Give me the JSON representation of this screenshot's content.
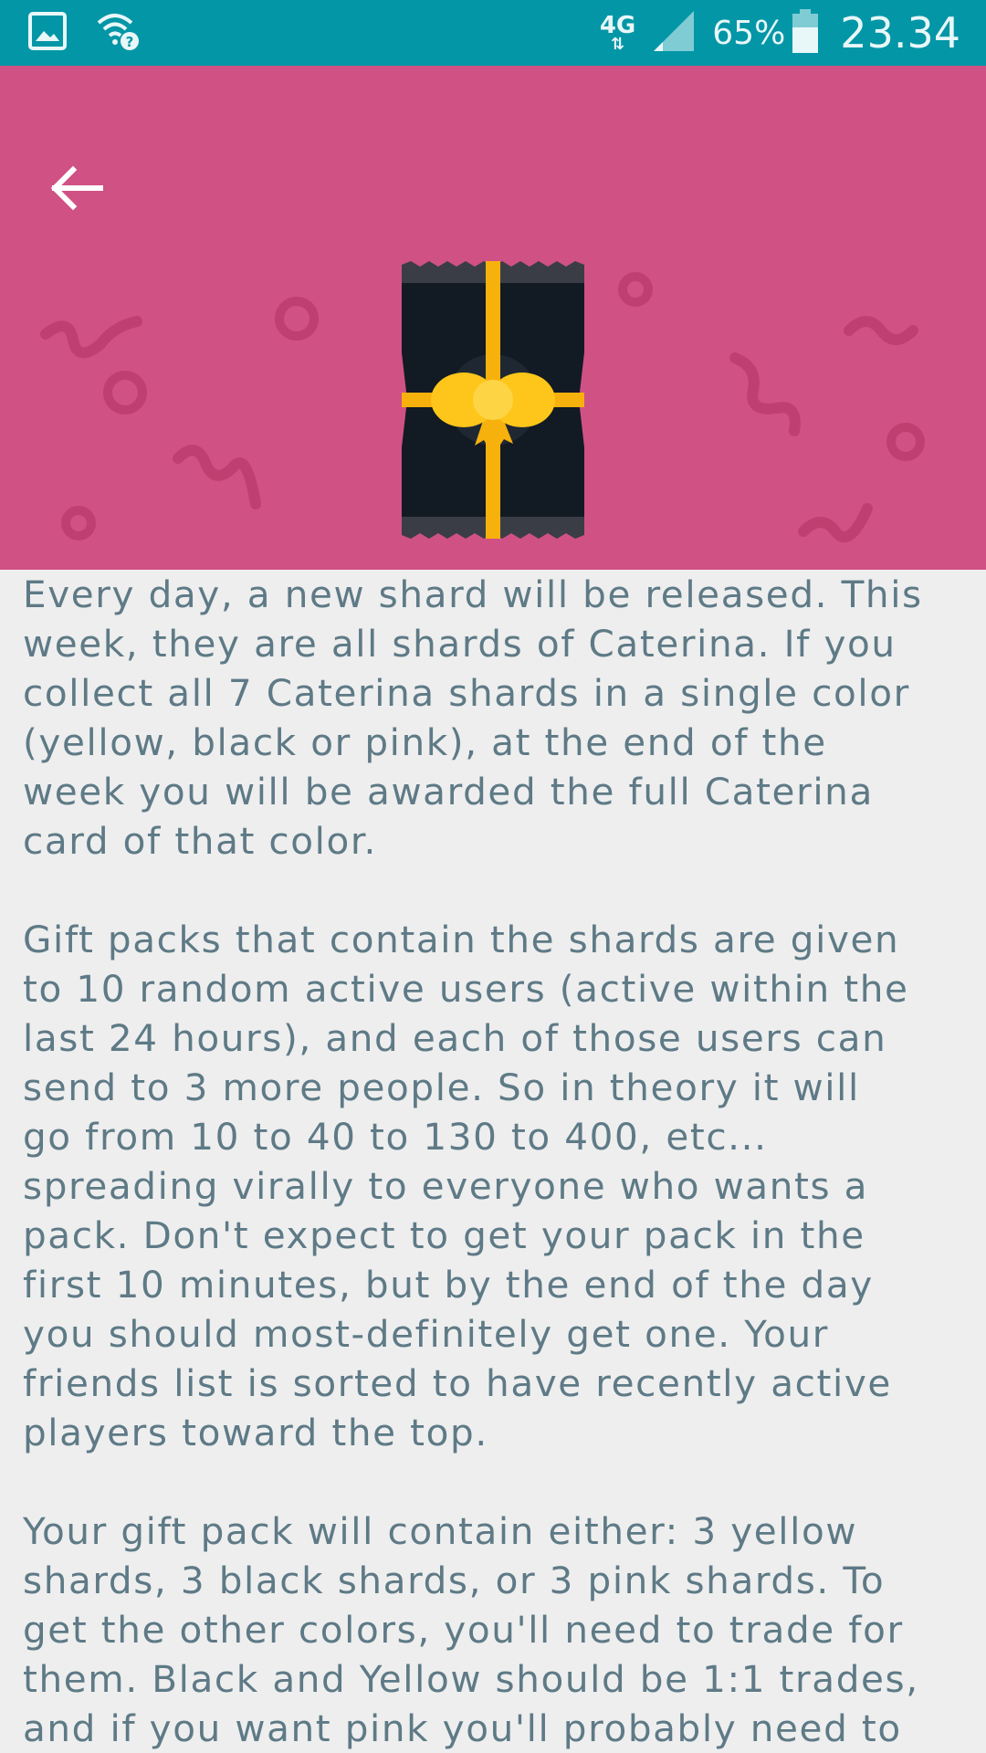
{
  "status_bar": {
    "network": "4G",
    "battery_percent": "65%",
    "time": "23.34",
    "icons": [
      "gallery-icon",
      "wifi-question-icon",
      "data-arrows-icon",
      "signal-icon",
      "battery-icon"
    ],
    "background": "#0396a6"
  },
  "header": {
    "background": "#d05184",
    "back_icon": "arrow-left-icon",
    "gift_icon": "gift-pack-icon"
  },
  "content": {
    "paragraphs": [
      "Every day, a new shard will be released. This\nweek, they are all shards of Caterina. If you\ncollect all 7 Caterina shards in a single color\n(yellow, black or pink), at the end of the\nweek you will be awarded the full Caterina\ncard of that color.",
      "Gift packs that contain the shards are given\nto 10 random active users (active within the\nlast 24 hours), and each of those users can\nsend to 3 more people. So in theory it will\ngo from 10 to 40 to 130 to 400, etc...\nspreading virally to everyone who wants a\npack. Don't expect to get your pack in the\nfirst 10 minutes, but by the end of the day\nyou should most-definitely get one. Your\nfriends list is sorted to have recently active\nplayers toward the top.",
      "Your gift pack will contain either: 3 yellow\nshards, 3 black shards, or 3 pink shards. To\nget the other colors, you'll need to trade for\nthem. Black and Yellow should be 1:1 trades,\nand if you want pink you'll probably need to"
    ],
    "text_color": "#5e7a86"
  }
}
